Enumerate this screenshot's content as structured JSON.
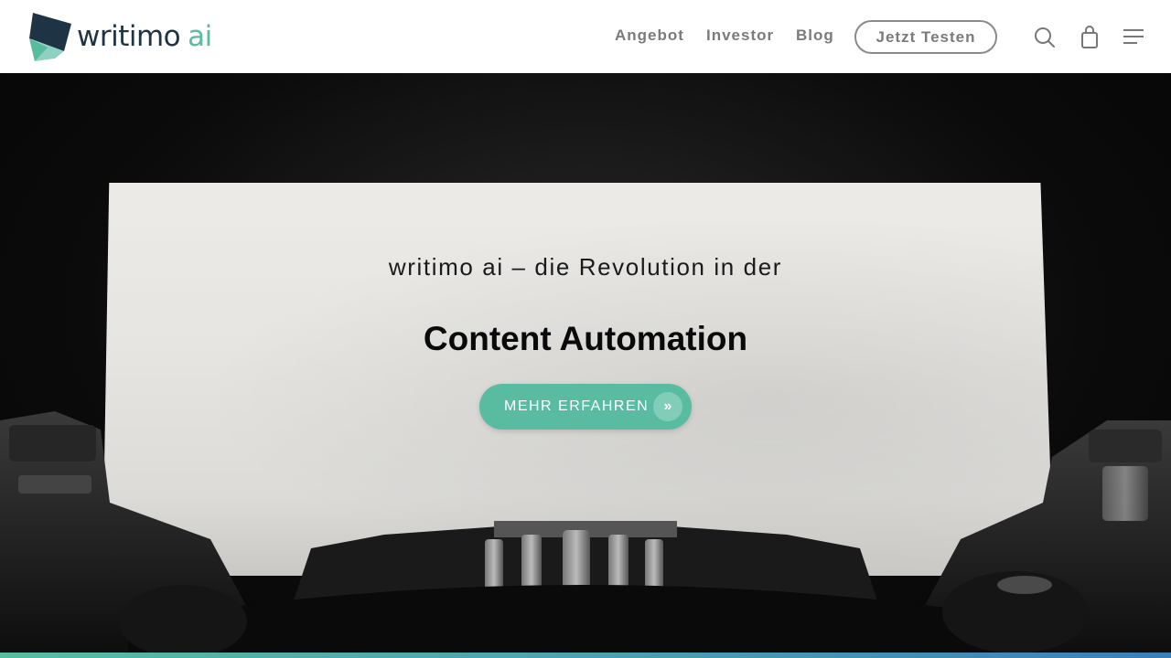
{
  "header": {
    "logo": {
      "main": "writimo",
      "accent": "ai"
    },
    "nav": [
      {
        "label": "Angebot"
      },
      {
        "label": "Investor"
      },
      {
        "label": "Blog"
      }
    ],
    "cta_label": "Jetzt Testen",
    "icons": [
      "search-icon",
      "shopping-bag-icon",
      "menu-icon"
    ]
  },
  "hero": {
    "subtitle": "writimo ai – die Revolution in der",
    "title": "Content Automation",
    "button_label": "MEHR ERFAHREN",
    "button_icon": "»"
  },
  "colors": {
    "brand_dark": "#1e3445",
    "accent_green": "#59bca0",
    "nav_text": "#7b7b7b"
  }
}
